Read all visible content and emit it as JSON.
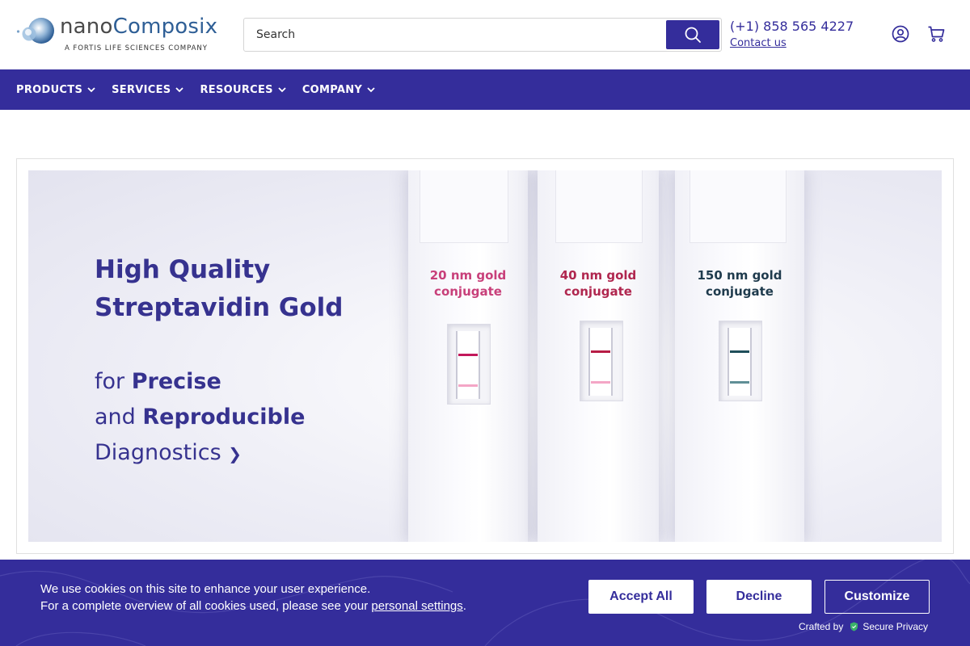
{
  "brand": {
    "name_part1": "nano",
    "name_part2": "Composix",
    "tagline": "A FORTIS LIFE SCIENCES COMPANY"
  },
  "search": {
    "placeholder": "Search"
  },
  "contact": {
    "phone": "(+1) 858 565 4227",
    "link_label": "Contact us"
  },
  "header_icons": [
    "account-icon",
    "cart-icon"
  ],
  "nav": {
    "items": [
      {
        "label": "PRODUCTS"
      },
      {
        "label": "SERVICES"
      },
      {
        "label": "RESOURCES"
      },
      {
        "label": "COMPANY"
      }
    ]
  },
  "banner": {
    "headline_line1": "High Quality",
    "headline_line2": "Streptavidin Gold",
    "sub_line1_prefix": "for ",
    "sub_line1_bold": "Precise",
    "sub_line2_prefix": "and ",
    "sub_line2_bold": "Reproducible",
    "sub_line3": "Diagnostics",
    "sub_line3_arrow": "❯",
    "cassettes": [
      {
        "size": "20 nm gold",
        "word": "conjugate",
        "label_color": "#c8407a",
        "line1_color": "#c2185b",
        "line2_color": "#f4a6c6"
      },
      {
        "size": "40 nm gold",
        "word": "conjugate",
        "label_color": "#b0274f",
        "line1_color": "#b71c45",
        "line2_color": "#f4a6c6"
      },
      {
        "size": "150 nm gold",
        "word": "conjugate",
        "label_color": "#1f3b4d",
        "line1_color": "#1f4e5a",
        "line2_color": "#5f8f96"
      }
    ]
  },
  "cookie": {
    "text_line1": "We use cookies on this site to enhance your user experience.",
    "text_line2_prefix": "For a complete overview of all cookies used, please see your ",
    "text_line2_link": "personal settings",
    "text_line2_suffix": ".",
    "accept_label": "Accept All",
    "decline_label": "Decline",
    "customize_label": "Customize",
    "crafted_by": "Crafted by",
    "crafted_brand": "Secure Privacy"
  },
  "colors": {
    "primary": "#342d9b",
    "headline": "#36328f",
    "logo_blue": "#2f5f96"
  }
}
